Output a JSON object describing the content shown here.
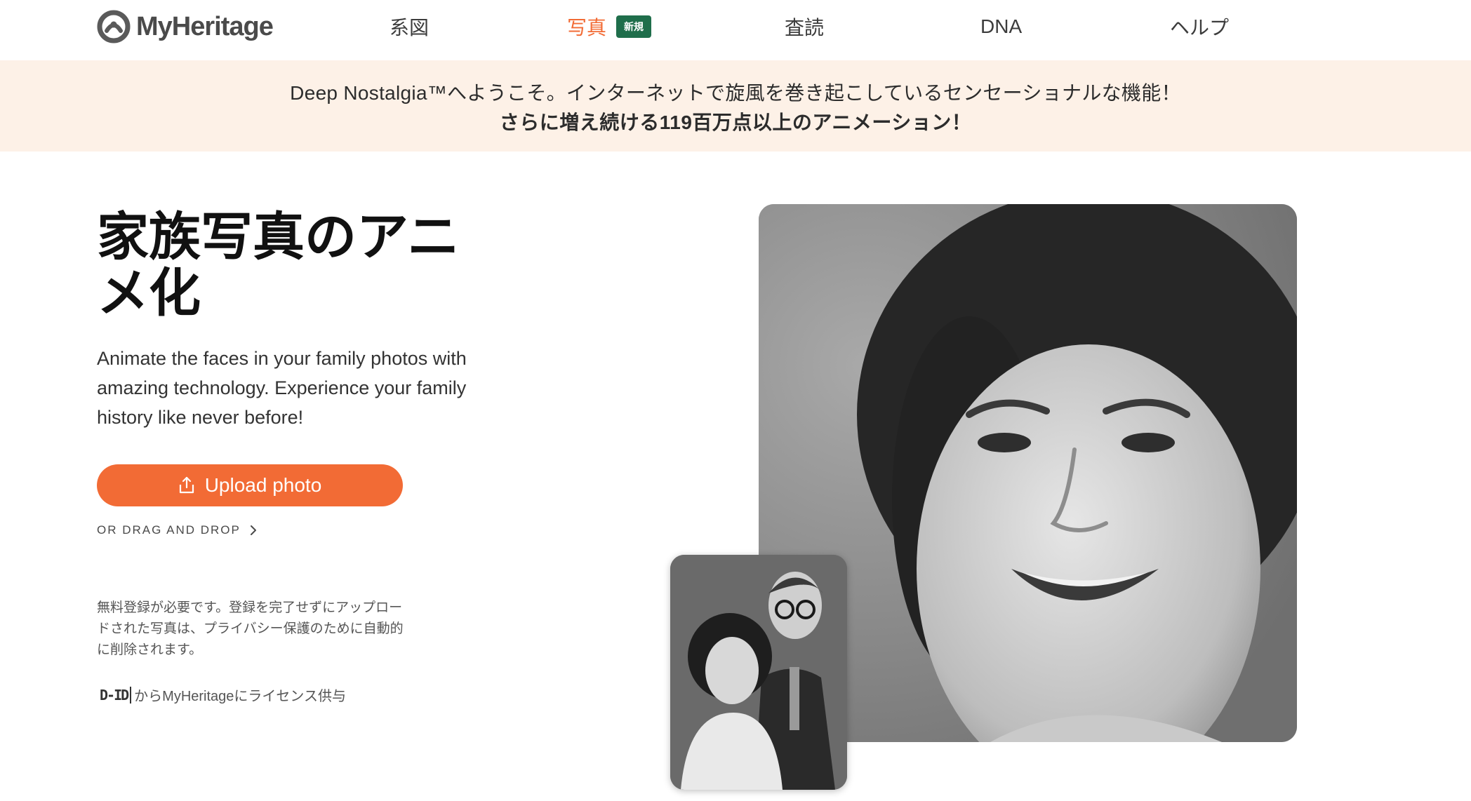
{
  "header": {
    "logo_text": "MyHeritage",
    "nav": [
      {
        "label": "系図"
      },
      {
        "label": "写真",
        "badge": "新規"
      },
      {
        "label": "査読"
      },
      {
        "label": "DNA"
      },
      {
        "label": "ヘルプ"
      }
    ]
  },
  "banner": {
    "line1": "Deep Nostalgia™へようこそ。インターネットで旋風を巻き起こしているセンセーショナルな機能！",
    "line2": "さらに増え続ける119百万点以上のアニメーション！"
  },
  "hero": {
    "title": "家族写真のアニメ化",
    "description": "Animate the faces in your family photos with amazing technology. Experience your family history like never before!",
    "upload_label": "Upload photo",
    "drag_drop_label": "OR DRAG AND DROP",
    "disclaimer": "無料登録が必要です。登録を完了せずにアップロードされた写真は、プライバシー保護のために自動的に削除されます。",
    "license_logo": "D-ID",
    "license_text": "からMyHeritageにライセンス供与"
  },
  "colors": {
    "accent": "#f26b35",
    "badge": "#1f6e4b",
    "banner_bg": "#fdf1e7"
  },
  "icons": [
    "myheritage-logo-icon",
    "upload-icon",
    "chevron-right-icon"
  ]
}
